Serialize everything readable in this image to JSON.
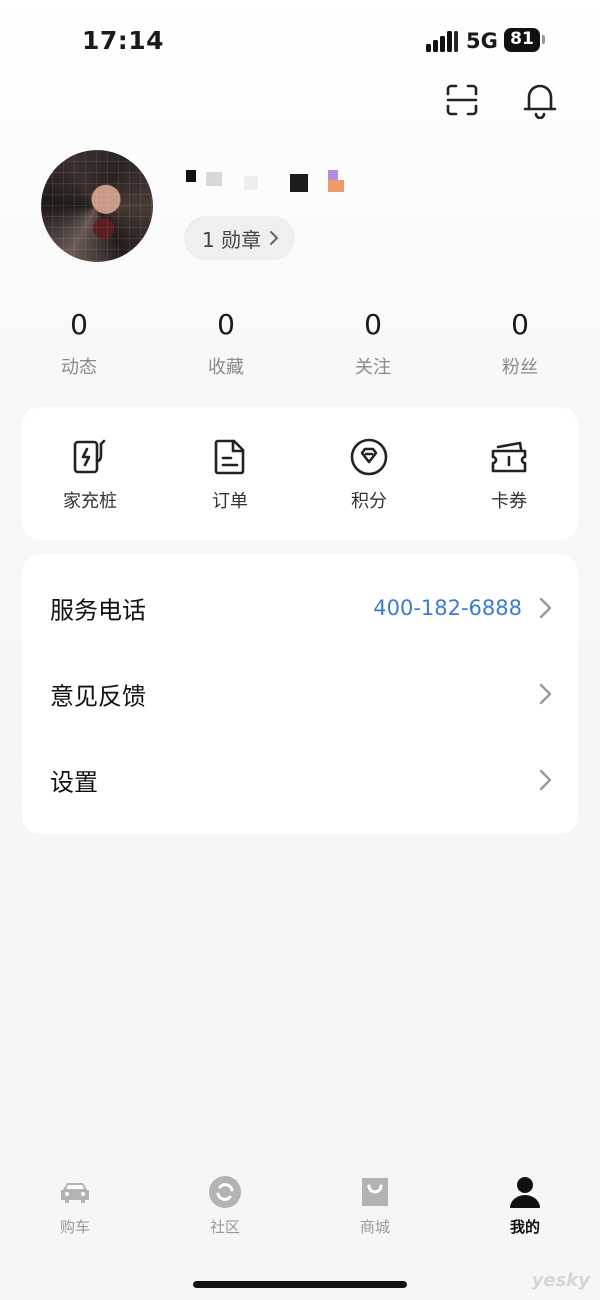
{
  "status_bar": {
    "time": "17:14",
    "network": "5G",
    "battery": "81"
  },
  "header": {
    "scan_icon": "scan-icon",
    "bell_icon": "bell-icon"
  },
  "profile": {
    "medal_text": "1 勋章"
  },
  "stats": [
    {
      "value": "0",
      "label": "动态"
    },
    {
      "value": "0",
      "label": "收藏"
    },
    {
      "value": "0",
      "label": "关注"
    },
    {
      "value": "0",
      "label": "粉丝"
    }
  ],
  "quick_actions": [
    {
      "label": "家充桩",
      "icon": "charger-icon"
    },
    {
      "label": "订单",
      "icon": "order-doc-icon"
    },
    {
      "label": "积分",
      "icon": "diamond-points-icon"
    },
    {
      "label": "卡券",
      "icon": "ticket-icon"
    }
  ],
  "menu": [
    {
      "label": "服务电话",
      "value": "400-182-6888"
    },
    {
      "label": "意见反馈",
      "value": ""
    },
    {
      "label": "设置",
      "value": ""
    }
  ],
  "tabs": [
    {
      "label": "购车",
      "icon": "car-icon",
      "active": false
    },
    {
      "label": "社区",
      "icon": "community-icon",
      "active": false
    },
    {
      "label": "商城",
      "icon": "shopping-bag-icon",
      "active": false
    },
    {
      "label": "我的",
      "icon": "person-icon",
      "active": true
    }
  ],
  "watermark": "yesky",
  "colors": {
    "accent_blue": "#3a7bd5",
    "active_tab": "#111111",
    "inactive_tab": "#9a9a9a"
  }
}
